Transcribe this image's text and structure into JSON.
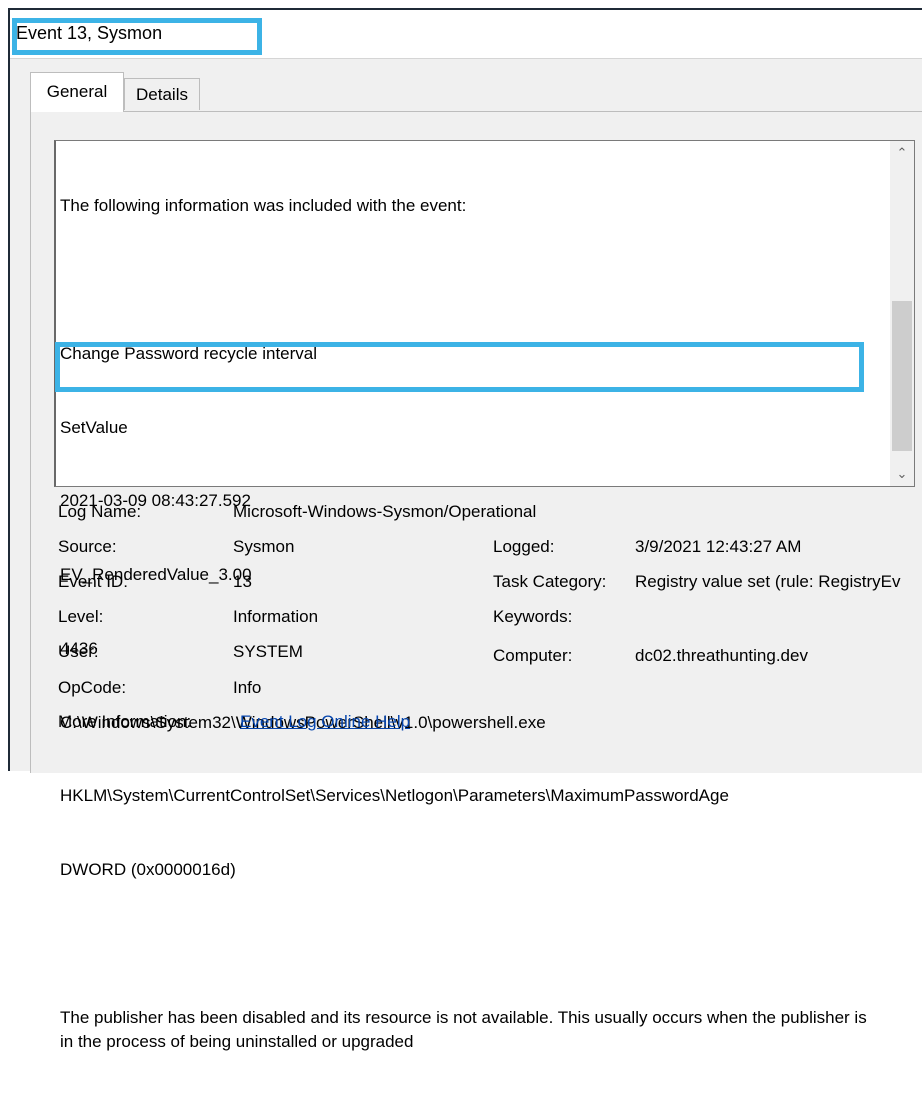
{
  "window": {
    "title": "Event 13, Sysmon"
  },
  "tabs": [
    {
      "label": "General",
      "active": true
    },
    {
      "label": "Details",
      "active": false
    }
  ],
  "description": {
    "lines": [
      "The following information was included with the event:",
      "",
      "Change Password recycle interval",
      "SetValue",
      "2021-03-09 08:43:27.592",
      "EV_RenderedValue_3.00",
      "4436",
      "C:\\Windows\\System32\\WindowsPowerShell\\v1.0\\powershell.exe",
      "HKLM\\System\\CurrentControlSet\\Services\\Netlogon\\Parameters\\MaximumPasswordAge",
      "DWORD (0x0000016d)",
      "",
      "The publisher has been disabled and its resource is not available. This usually occurs when the publisher is in the process of being uninstalled or upgraded"
    ]
  },
  "scrollbar": {
    "up_icon": "chevron-up-icon",
    "down_icon": "chevron-down-icon"
  },
  "details": {
    "log_name": {
      "label": "Log Name:",
      "value": "Microsoft-Windows-Sysmon/Operational"
    },
    "source": {
      "label": "Source:",
      "value": "Sysmon"
    },
    "logged": {
      "label": "Logged:",
      "value": "3/9/2021 12:43:27 AM"
    },
    "event_id": {
      "label": "Event ID:",
      "value": "13"
    },
    "task_category": {
      "label": "Task Category:",
      "value": "Registry value set (rule: RegistryEv"
    },
    "level": {
      "label": "Level:",
      "value": "Information"
    },
    "keywords": {
      "label": "Keywords:",
      "value": ""
    },
    "user": {
      "label": "User:",
      "value": "SYSTEM"
    },
    "computer": {
      "label": "Computer:",
      "value": "dc02.threathunting.dev"
    },
    "opcode": {
      "label": "OpCode:",
      "value": "Info"
    },
    "more_info": {
      "label": "More Information:",
      "link": "Event Log Online Help"
    }
  },
  "colors": {
    "highlight": "#3cb3e6",
    "link": "#0645ad"
  }
}
